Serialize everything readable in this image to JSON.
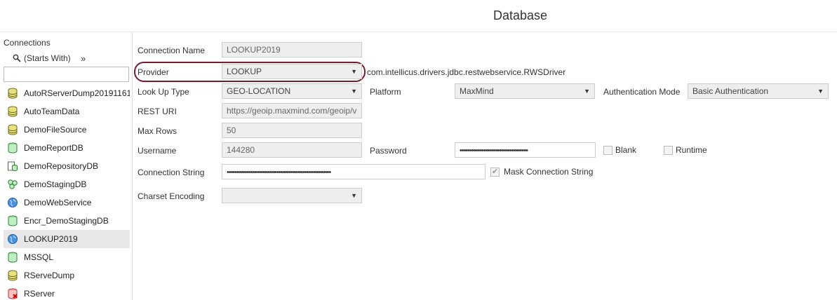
{
  "page": {
    "title": "Database"
  },
  "sidebar": {
    "header": "Connections",
    "filter_label": "(Starts With)",
    "more": "»",
    "search_value": "",
    "items": [
      {
        "label": "AutoRServerDump20191161",
        "icon": "db-yellow-icon"
      },
      {
        "label": "AutoTeamData",
        "icon": "db-yellow-icon"
      },
      {
        "label": "DemoFileSource",
        "icon": "db-yellow-icon"
      },
      {
        "label": "DemoReportDB",
        "icon": "db-green-icon"
      },
      {
        "label": "DemoRepositoryDB",
        "icon": "repository-icon"
      },
      {
        "label": "DemoStagingDB",
        "icon": "staging-icon"
      },
      {
        "label": "DemoWebService",
        "icon": "globe-icon"
      },
      {
        "label": "Encr_DemoStagingDB",
        "icon": "db-green-icon"
      },
      {
        "label": "LOOKUP2019",
        "icon": "globe-icon",
        "selected": true
      },
      {
        "label": "MSSQL",
        "icon": "db-green-icon"
      },
      {
        "label": "RServeDump",
        "icon": "db-yellow-icon"
      },
      {
        "label": "RServer",
        "icon": "db-error-icon"
      }
    ]
  },
  "form": {
    "connection_name": {
      "label": "Connection Name",
      "value": "LOOKUP2019"
    },
    "provider": {
      "label": "Provider",
      "value": "LOOKUP",
      "driver": "com.intellicus.drivers.jdbc.restwebservice.RWSDriver"
    },
    "lookup_type": {
      "label": "Look Up Type",
      "value": "GEO-LOCATION"
    },
    "platform": {
      "label": "Platform",
      "value": "MaxMind"
    },
    "auth_mode": {
      "label": "Authentication Mode",
      "value": "Basic Authentication"
    },
    "rest_uri": {
      "label": "REST URI",
      "value": "https://geoip.maxmind.com/geoip/v"
    },
    "max_rows": {
      "label": "Max Rows",
      "value": "50"
    },
    "username": {
      "label": "Username",
      "value": "144280"
    },
    "password": {
      "label": "Password",
      "value": "••••••••••••••••••••••••••••••••••"
    },
    "blank": {
      "label": "Blank",
      "checked": false
    },
    "runtime": {
      "label": "Runtime",
      "checked": false
    },
    "connection_string": {
      "label": "Connection String",
      "value": "••••••••••••••••••••••••••••••••••••••••••••••••••••"
    },
    "mask_connection_string": {
      "label": "Mask Connection String",
      "checked": true
    },
    "charset_encoding": {
      "label": "Charset Encoding",
      "value": ""
    }
  },
  "colors": {
    "highlight_ring": "#7a1a2a",
    "selected_row": "#e7e7e7"
  }
}
